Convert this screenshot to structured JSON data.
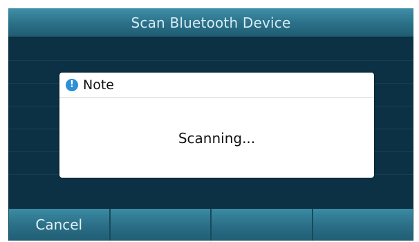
{
  "screen": {
    "title": "Scan Bluetooth Device"
  },
  "dialog": {
    "icon": "info-icon",
    "icon_glyph": "!",
    "title": "Note",
    "message": "Scanning..."
  },
  "softkeys": [
    {
      "label": "Cancel"
    },
    {
      "label": ""
    },
    {
      "label": ""
    },
    {
      "label": ""
    }
  ],
  "colors": {
    "background": "#0d3144",
    "title_bar": "#2a6f87",
    "info_icon": "#2d8fd6",
    "dialog_bg": "#ffffff"
  }
}
